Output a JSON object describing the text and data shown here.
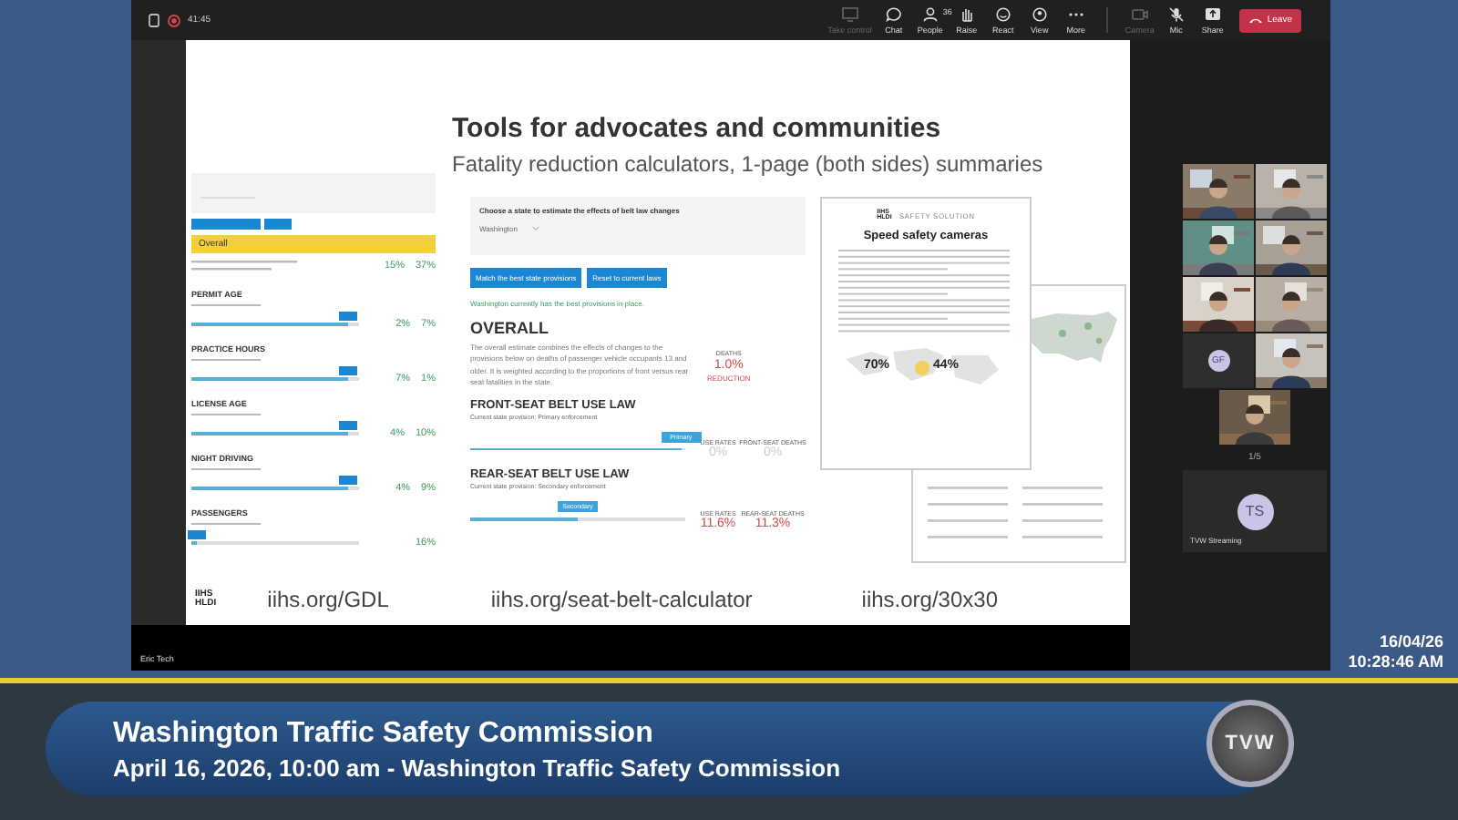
{
  "toolbar": {
    "timer": "41:45",
    "buttons": [
      {
        "kind": "control",
        "label": "Take control",
        "disabled": true
      },
      {
        "kind": "chat",
        "label": "Chat",
        "disabled": false
      },
      {
        "kind": "people",
        "label": "People",
        "count": "36",
        "disabled": false
      },
      {
        "kind": "raise",
        "label": "Raise",
        "disabled": false
      },
      {
        "kind": "react",
        "label": "React",
        "disabled": false
      },
      {
        "kind": "view",
        "label": "View",
        "disabled": false
      },
      {
        "kind": "more",
        "label": "More",
        "disabled": false
      },
      {
        "kind": "camera",
        "label": "Camera",
        "disabled": true
      },
      {
        "kind": "mic",
        "label": "Mic",
        "disabled": false
      },
      {
        "kind": "share",
        "label": "Share",
        "disabled": false
      }
    ],
    "leave": "Leave"
  },
  "slide": {
    "title": "Tools for advocates and communities",
    "subtitle": "Fatality reduction calculators, 1-page (both sides) summaries",
    "gdl": {
      "overall": "Overall",
      "overall_values": [
        "15%",
        "37%"
      ],
      "rows": [
        {
          "label": "PERMIT AGE",
          "level": 0.93,
          "values": [
            "2%",
            "7%"
          ]
        },
        {
          "label": "PRACTICE HOURS",
          "level": 0.93,
          "values": [
            "7%",
            "1%"
          ]
        },
        {
          "label": "LICENSE AGE",
          "level": 0.93,
          "values": [
            "4%",
            "10%"
          ]
        },
        {
          "label": "NIGHT DRIVING",
          "level": 0.93,
          "values": [
            "4%",
            "9%"
          ]
        },
        {
          "label": "PASSENGERS",
          "level": 0.03,
          "values": [
            "16%"
          ]
        }
      ]
    },
    "calculator": {
      "prompt": "Choose a state to estimate the effects of belt law changes",
      "state": "Washington",
      "buttons": [
        "Match the best state provisions",
        "Reset to current laws"
      ],
      "notice": "Washington currently has the best provisions in place.",
      "overall": "OVERALL",
      "description": "The overall estimate combines the effects of changes to the provisions below on deaths of passenger vehicle occupants 13 and older. It is weighted according to the proportions of front versus rear seat fatalities in the state.",
      "overall_result": {
        "label": "DEATHS",
        "value": "1.0%",
        "note": "REDUCTION"
      },
      "laws": [
        {
          "title": "FRONT-SEAT BELT USE LAW",
          "provision": "Current state provision: Primary enforcement",
          "option": "Primary",
          "level": 0.98,
          "changed": false,
          "results": [
            {
              "label": "USE RATES",
              "value": "0%"
            },
            {
              "label": "FRONT-SEAT DEATHS",
              "value": "0%"
            }
          ]
        },
        {
          "title": "REAR-SEAT BELT USE LAW",
          "provision": "Current state provision: Secondary enforcement",
          "option": "Secondary",
          "level": 0.5,
          "changed": true,
          "results": [
            {
              "label": "USE RATES",
              "value": "11.6%"
            },
            {
              "label": "REAR-SEAT DEATHS",
              "value": "11.3%"
            }
          ]
        }
      ]
    },
    "brochure": {
      "logo": [
        "IIHS",
        "HLDI"
      ],
      "label": "SAFETY SOLUTION",
      "title": "Speed safety cameras",
      "stats": [
        "70%",
        "44%"
      ]
    },
    "logo": [
      "IIHS",
      "HLDI"
    ],
    "links": [
      "iihs.org/GDL",
      "iihs.org/seat-belt-calculator",
      "iihs.org/30x30"
    ]
  },
  "presenter": "Eric Tech",
  "participants": {
    "tiles": [
      {
        "kind": "video"
      },
      {
        "kind": "video"
      },
      {
        "kind": "video"
      },
      {
        "kind": "video"
      },
      {
        "kind": "video"
      },
      {
        "kind": "video"
      },
      {
        "kind": "avatar",
        "initials": "GF"
      },
      {
        "kind": "video"
      },
      {
        "kind": "video"
      }
    ],
    "pager": "1/5",
    "self": {
      "initials": "TS",
      "name": "TVW Streaming"
    }
  },
  "clock": {
    "date": "16/04/26",
    "time": "10:28:46 AM"
  },
  "lower_third": {
    "title": "Washington Traffic Safety Commission",
    "subtitle": "April 16, 2026, 10:00 am - Washington Traffic Safety Commission",
    "logo": "TVW"
  }
}
